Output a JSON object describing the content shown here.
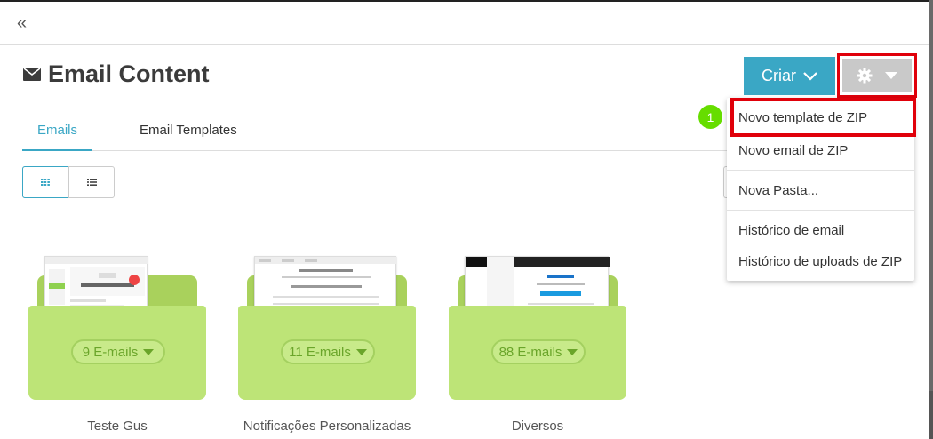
{
  "header": {
    "collapse_glyph": "«"
  },
  "page": {
    "title": "Email Content",
    "title_icon": "envelope-icon"
  },
  "toolbar": {
    "criar_label": "Criar",
    "settings_icon": "gear-icon"
  },
  "tabs": [
    {
      "label": "Emails",
      "active": true
    },
    {
      "label": "Email Templates",
      "active": false
    }
  ],
  "view_toggle": {
    "grid_icon": "grid-icon",
    "list_icon": "list-icon"
  },
  "folders": [
    {
      "badge": "9 E-mails",
      "name": "Teste Gus"
    },
    {
      "badge": "11 E-mails",
      "name": "Notificações Personalizadas"
    },
    {
      "badge": "88 E-mails",
      "name": "Diversos"
    }
  ],
  "dropdown": {
    "items": [
      "Novo template de ZIP",
      "Novo email de ZIP",
      "Nova Pasta...",
      "Histórico de email",
      "Histórico de uploads de ZIP"
    ]
  },
  "annotation": {
    "step": "1"
  },
  "colors": {
    "accent": "#3aa7c5",
    "highlight": "#e0000a",
    "folder": "#bde477",
    "step": "#66dd00"
  }
}
